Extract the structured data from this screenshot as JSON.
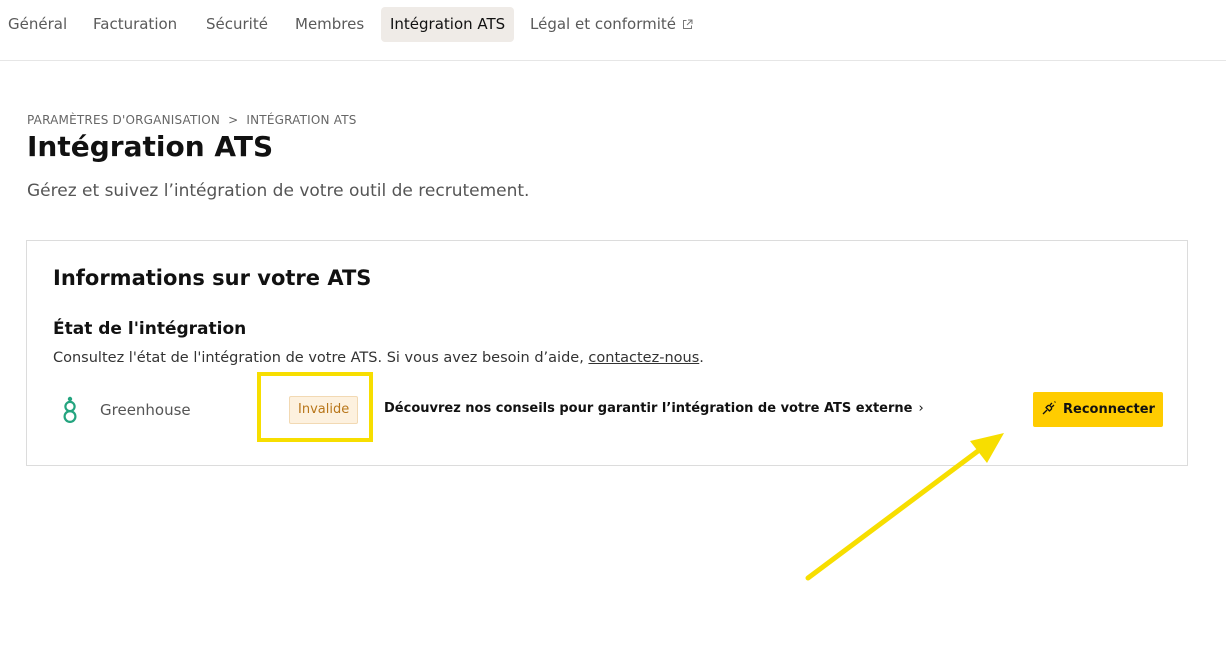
{
  "nav": {
    "tabs": [
      {
        "label": "Général"
      },
      {
        "label": "Facturation"
      },
      {
        "label": "Sécurité"
      },
      {
        "label": "Membres"
      },
      {
        "label": "Intégration ATS"
      },
      {
        "label": "Légal et conformité"
      }
    ],
    "active_tab": "Intégration ATS"
  },
  "breadcrumb": {
    "parent": "PARAMÈTRES D'ORGANISATION",
    "current": "INTÉGRATION ATS"
  },
  "page": {
    "title": "Intégration ATS",
    "subtitle": "Gérez et suivez l’intégration de votre outil de recrutement."
  },
  "card": {
    "title": "Informations sur votre ATS",
    "section_title": "État de l'intégration",
    "description": "Consultez l'état de l'intégration de votre ATS. Si vous avez besoin d’aide, ",
    "contact_link": "contactez-nous",
    "description_end": ".",
    "ats": {
      "logo_icon": "greenhouse-logo-icon",
      "name": "Greenhouse",
      "status": "Invalide",
      "status_color": "#b8761a",
      "tips_link": "Découvrez nos conseils pour garantir l’intégration de votre ATS externe",
      "reconnect_label": "Reconnecter",
      "reconnect_icon": "plug-icon"
    }
  },
  "colors": {
    "accent": "#ffcc00",
    "annotation": "#f7de00",
    "brand_green": "#24a47f"
  }
}
